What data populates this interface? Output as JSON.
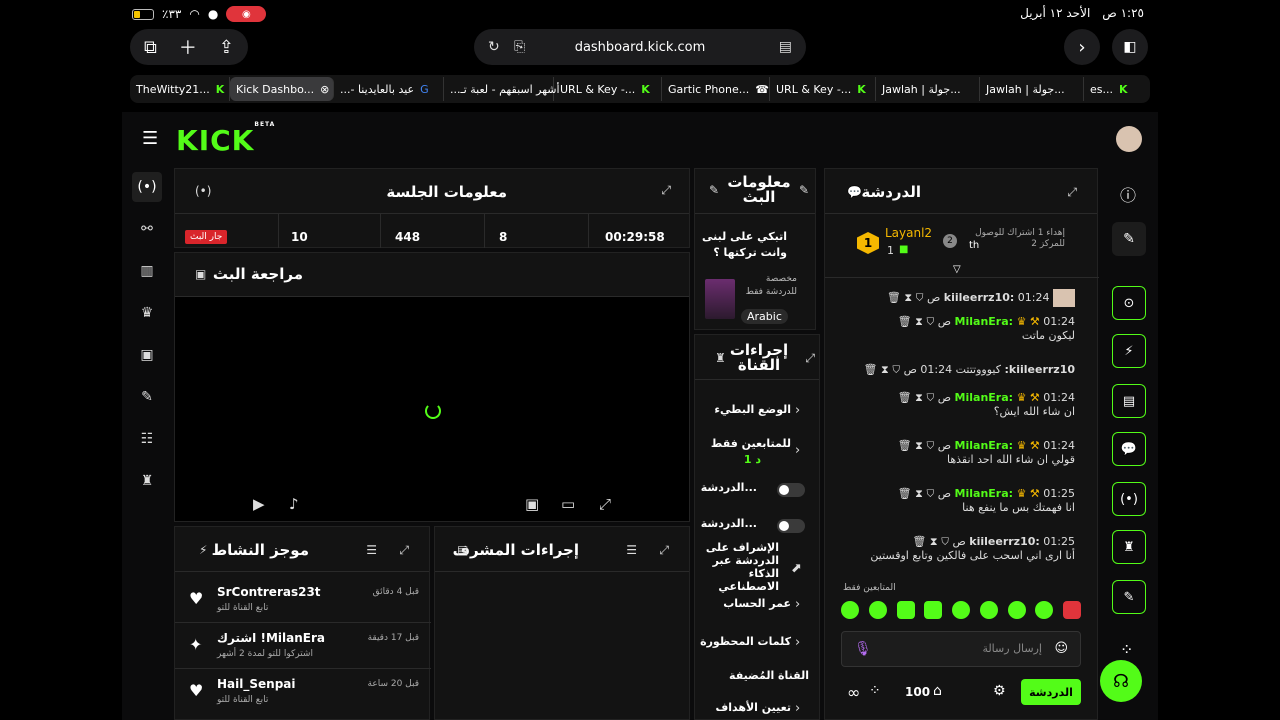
{
  "status": {
    "time": "١:٢٥ ص",
    "date": "الأحد ١٢ أبريل",
    "battery": "٪٣٣"
  },
  "browser": {
    "url": "dashboard.kick.com",
    "tabs": [
      {
        "label": "TheWitty21..."
      },
      {
        "label": "Kick Dashbo..."
      },
      {
        "label": "عيد بالعايدينا -..."
      },
      {
        "label": "أشهر اسبقهم - لعبة تـ..."
      },
      {
        "label": "URL & Key -..."
      },
      {
        "label": "Gartic Phone..."
      },
      {
        "label": "URL & Key -..."
      },
      {
        "label": "Jawlah | جولة..."
      },
      {
        "label": "Jawlah | جولة..."
      },
      {
        "label": "es..."
      }
    ]
  },
  "kick": {
    "logo": "KICK",
    "beta": "BETA"
  },
  "session": {
    "title": "معلومات الجلسة",
    "live_badge": "جار البث",
    "stats": [
      "10",
      "448",
      "8",
      "00:29:58"
    ]
  },
  "preview": {
    "title": "مراجعة البث"
  },
  "stream_info": {
    "title": "معلومات البث",
    "stream_title": "اتبكي على لبنى وانت تركتها ؟",
    "category": "مخصصة للدردشة فقط",
    "language": "Arabic"
  },
  "channel_actions": {
    "title": "إجراءات القناة",
    "items": [
      "الوضع البطيء",
      "للمتابعين فقط",
      "الدردشة...",
      "الدردشة...",
      "الإشراف على الدردشة عبر الذكاء الاصطناعي",
      "عمر الحساب",
      "كلمات المحظورة",
      "القناة المُضيفة",
      "تعيين الأهداف"
    ],
    "followers_duration": "1 د"
  },
  "activity": {
    "title": "موجز النشاط",
    "items": [
      {
        "user": "SrContreras23t",
        "sub": "تابع القناة للتو",
        "time": "قبل 4 دقائق"
      },
      {
        "user": "MilanEra! اشترك",
        "sub": "اشتركوا للتو لمدة 2 أشهر",
        "time": "قبل 17 دقيقة"
      },
      {
        "user": "Hail_Senpai",
        "sub": "تابع القناة للتو",
        "time": "قبل 20 ساعة"
      }
    ]
  },
  "mod_actions": {
    "title": "إجراءات المشرف"
  },
  "chat": {
    "title": "الدردشة",
    "top_gifter": "Layanl2",
    "top_count": "1",
    "rank_text": "إهداء 1 اشتراك للوصول للمركز 2",
    "rank_user": "th",
    "messages": [
      {
        "user": "kiileerrz10:",
        "time": "01:24 ص",
        "text": ""
      },
      {
        "user": "MilanEra:",
        "time": "01:24 ص",
        "text": "ليكون ماتت"
      },
      {
        "user": "kiileerrz10:",
        "time": "01:24 ص",
        "text": "كيوووتتتت"
      },
      {
        "user": "MilanEra:",
        "time": "01:24 ص",
        "text": "ان شاء الله ايش؟"
      },
      {
        "user": "MilanEra:",
        "time": "01:24 ص",
        "text": "قولي ان شاء الله احد انقذها"
      },
      {
        "user": "MilanEra:",
        "time": "01:25 ص",
        "text": "انا فهمتك بس ما ينفع هنا"
      },
      {
        "user": "kiileerrz10:",
        "time": "01:25 ص",
        "text": "أنا ارى اني اسحب على فالكين وتابع اوقستين"
      }
    ],
    "followers_only": "المتابعين فقط",
    "input_placeholder": "إرسال رسالة",
    "count": "100",
    "send": "الدردشة"
  }
}
